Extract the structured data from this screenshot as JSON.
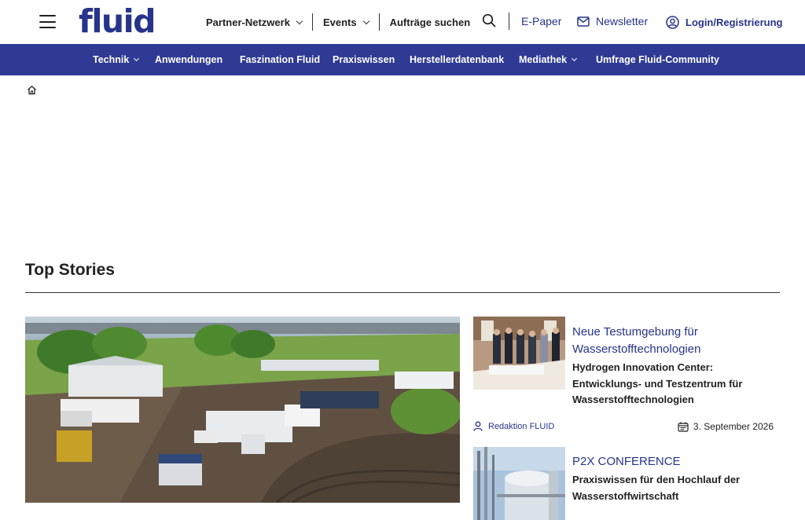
{
  "brand": {
    "logo_text": "fluid",
    "color": "#27348b",
    "nav_bg": "#2e3a93"
  },
  "header": {
    "menu_icon": "hamburger-menu-icon",
    "nav": [
      {
        "label": "Partner-Netzwerk",
        "has_dropdown": true
      },
      {
        "label": "Events",
        "has_dropdown": true
      },
      {
        "label": "Aufträge suchen",
        "has_dropdown": false
      }
    ],
    "search_icon": "search-icon",
    "epaper_label": "E-Paper",
    "newsletter_label": "Newsletter",
    "login_label": "Login/Registrierung"
  },
  "main_nav": [
    {
      "label": "Technik",
      "has_dropdown": true
    },
    {
      "label": "Anwendungen",
      "has_dropdown": false
    },
    {
      "label": "Faszination Fluid",
      "has_dropdown": false
    },
    {
      "label": "Praxiswissen",
      "has_dropdown": false
    },
    {
      "label": "Herstellerdatenbank",
      "has_dropdown": false
    },
    {
      "label": "Mediathek",
      "has_dropdown": true
    },
    {
      "label": "Umfrage Fluid-Community",
      "has_dropdown": false
    }
  ],
  "breadcrumb": {
    "home_icon": "home-icon"
  },
  "top_stories": {
    "title": "Top Stories",
    "stories": [
      {
        "kicker": "Neue Testumgebung für Wasserstofftechnologien",
        "headline": "Hydrogen Innovation Center: Entwicklungs- und Testzentrum für Wasserstofftechnologien",
        "author": "Redaktion FLUID",
        "date": "3. September 2026"
      },
      {
        "kicker": "P2X CONFERENCE",
        "headline": "Praxiswissen für den Hochlauf der Wasserstoffwirtschaft"
      }
    ]
  }
}
